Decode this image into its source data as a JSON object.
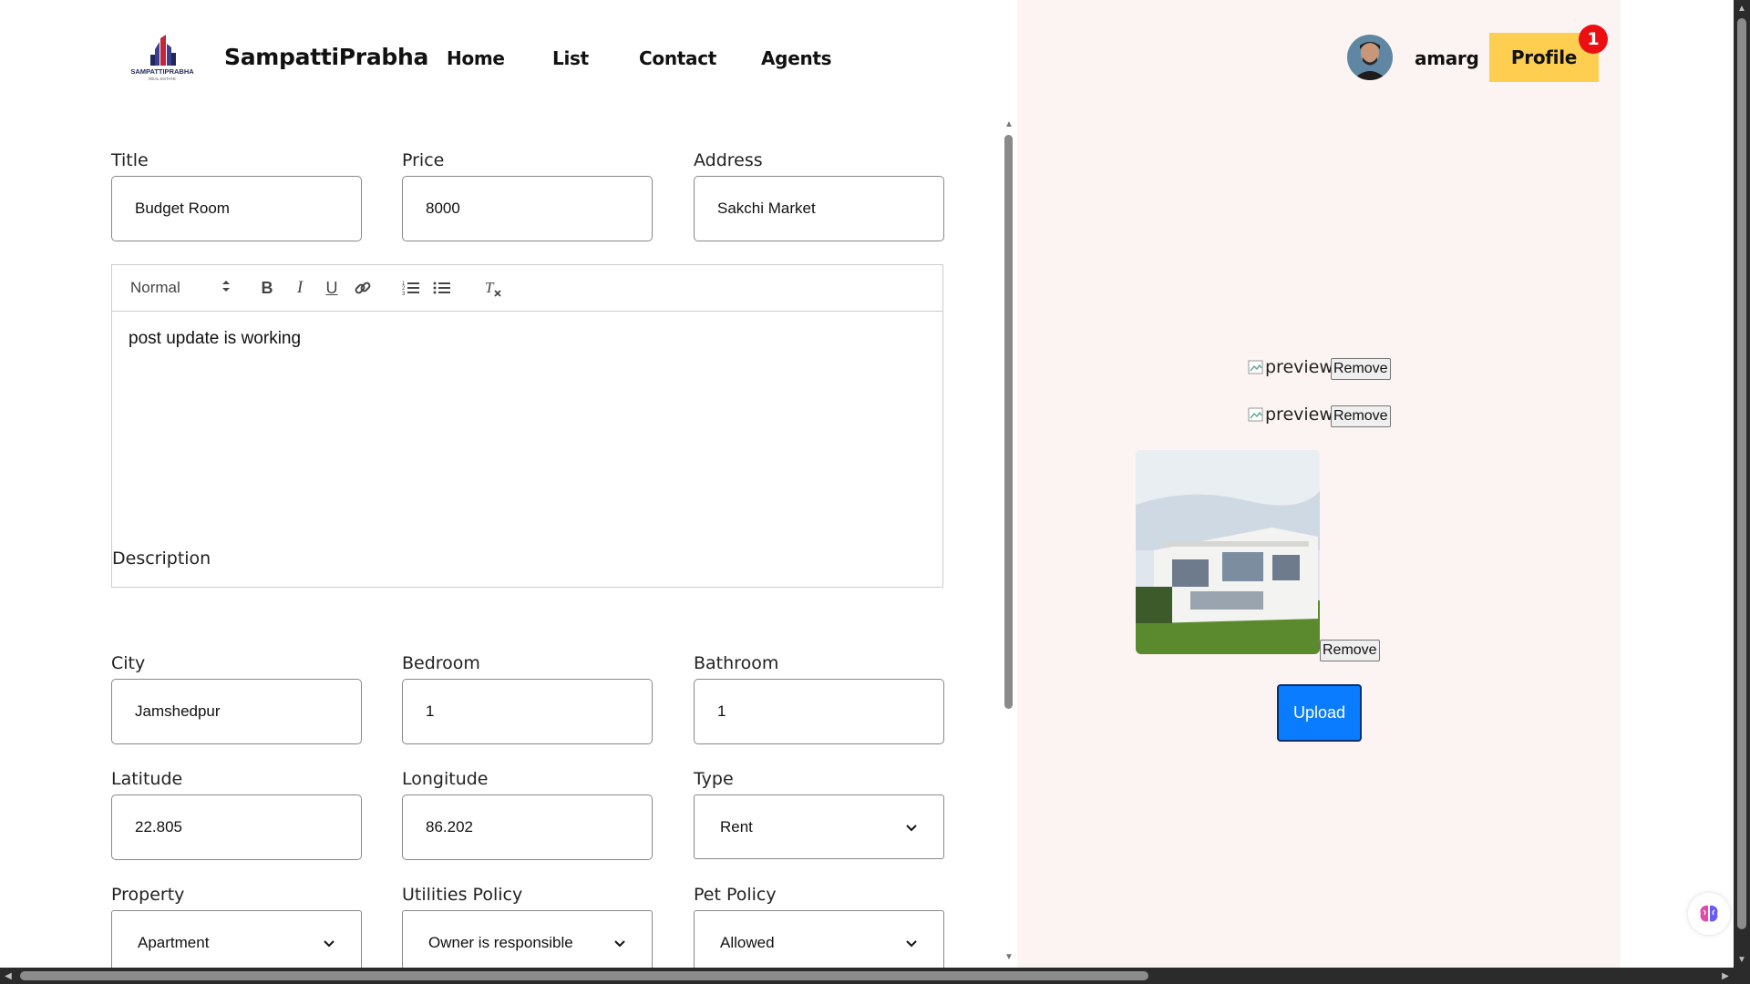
{
  "nav": {
    "brand": "SampattiPrabha",
    "logo_text": "SAMPATTIPRABHA",
    "logo_subtext": "REAL ESTATE",
    "links": [
      "Home",
      "List",
      "Contact",
      "Agents"
    ],
    "username": "amarg",
    "profile_label": "Profile",
    "notification_count": "1",
    "accent": "#fece51"
  },
  "form": {
    "title": {
      "label": "Title",
      "value": "Budget Room"
    },
    "price": {
      "label": "Price",
      "value": "8000"
    },
    "address": {
      "label": "Address",
      "value": "Sakchi Market"
    },
    "editor": {
      "format": "Normal",
      "content": "post update is working",
      "label": "Description"
    },
    "city": {
      "label": "City",
      "value": "Jamshedpur"
    },
    "bedroom": {
      "label": "Bedroom",
      "value": "1"
    },
    "bathroom": {
      "label": "Bathroom",
      "value": "1"
    },
    "latitude": {
      "label": "Latitude",
      "value": "22.805"
    },
    "longitude": {
      "label": "Longitude",
      "value": "86.202"
    },
    "type": {
      "label": "Type",
      "value": "Rent"
    },
    "property": {
      "label": "Property",
      "value": "Apartment"
    },
    "utilities": {
      "label": "Utilities Policy",
      "value": "Owner is responsible"
    },
    "pet": {
      "label": "Pet Policy",
      "value": "Allowed"
    }
  },
  "images": {
    "broken_alt": "preview",
    "remove_label": "Remove",
    "upload_label": "Upload",
    "upload_color": "#0a7cff"
  }
}
